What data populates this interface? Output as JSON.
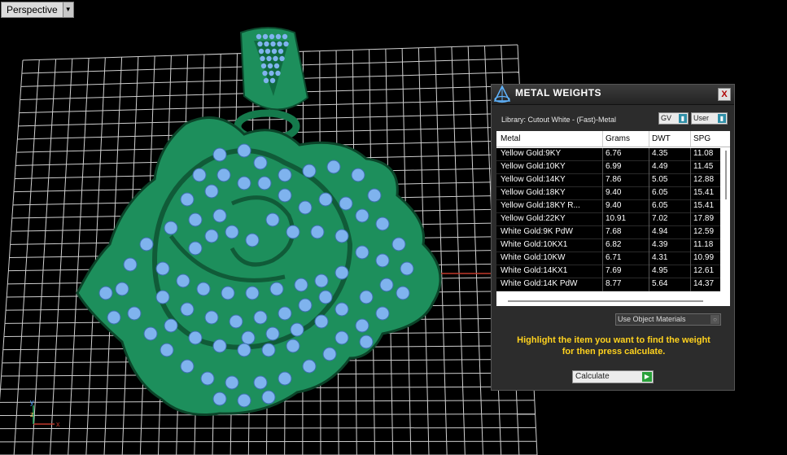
{
  "viewport": {
    "label": "Perspective",
    "dropdown_icon": "triangle-down",
    "axis_labels": {
      "x": "x",
      "y": "y",
      "z": "z"
    },
    "colors": {
      "background": "#000000",
      "grid": "#cfcfcf",
      "metal": "#1d8f5c",
      "stones": "#7fb3ee"
    }
  },
  "panel": {
    "title": "METAL WEIGHTS",
    "close_label": "X",
    "library_label": "Library: Cutout White - (Fast)-Metal",
    "gv_label": "GV",
    "user_label": "User",
    "columns": [
      "Metal",
      "Grams",
      "DWT",
      "SPG"
    ],
    "rows": [
      [
        "Yellow Gold:9KY",
        "6.76",
        "4.35",
        "11.08"
      ],
      [
        "Yellow Gold:10KY",
        "6.99",
        "4.49",
        "11.45"
      ],
      [
        "Yellow Gold:14KY",
        "7.86",
        "5.05",
        "12.88"
      ],
      [
        "Yellow Gold:18KY",
        "9.40",
        "6.05",
        "15.41"
      ],
      [
        "Yellow Gold:18KY R...",
        "9.40",
        "6.05",
        "15.41"
      ],
      [
        "Yellow Gold:22KY",
        "10.91",
        "7.02",
        "17.89"
      ],
      [
        "White Gold:9K PdW",
        "7.68",
        "4.94",
        "12.59"
      ],
      [
        "White Gold:10KX1",
        "6.82",
        "4.39",
        "11.18"
      ],
      [
        "White Gold:10KW",
        "6.71",
        "4.31",
        "10.99"
      ],
      [
        "White Gold:14KX1",
        "7.69",
        "4.95",
        "12.61"
      ],
      [
        "White Gold:14K PdW",
        "8.77",
        "5.64",
        "14.37"
      ]
    ],
    "use_materials_label": "Use Object Materials",
    "hint_line1": "Highlight the item you want to find the weight",
    "hint_line2": "for then press calculate.",
    "calculate_label": "Calculate",
    "colors": {
      "background": "#2c2c2c",
      "hint": "#ffd21e",
      "toggle_knob": "#2f8ea6",
      "calc_go": "#2aa03a"
    }
  }
}
